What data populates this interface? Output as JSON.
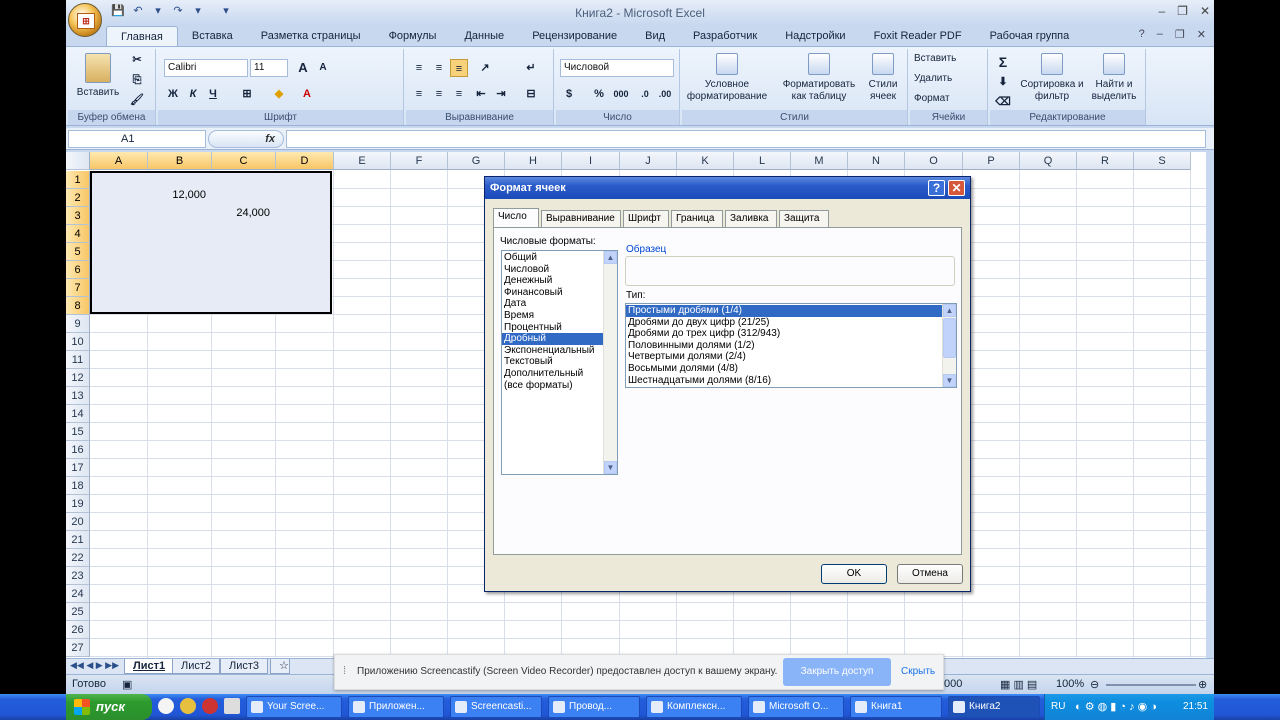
{
  "window": {
    "title": "Книга2 - Microsoft Excel",
    "controls": [
      "–",
      "❐",
      "✕"
    ],
    "office_logo": "Office"
  },
  "qat": [
    "💾",
    "↶",
    "▾",
    "↷",
    "▾",
    "▾"
  ],
  "tabs": [
    "Главная",
    "Вставка",
    "Разметка страницы",
    "Формулы",
    "Данные",
    "Рецензирование",
    "Вид",
    "Разработчик",
    "Надстройки",
    "Foxit Reader PDF",
    "Рабочая группа"
  ],
  "tabs_right": [
    "?",
    "–",
    "❐",
    "✕"
  ],
  "ribbon": {
    "groups": {
      "clipboard": "Буфер обмена",
      "font": "Шрифт",
      "alignment": "Выравнивание",
      "number": "Число",
      "styles": "Стили",
      "cells": "Ячейки",
      "editing": "Редактирование"
    },
    "paste": "Вставить",
    "font_name": "Calibri",
    "font_size": "11",
    "font_grow": "A",
    "font_shrink": "A",
    "bold": "Ж",
    "italic": "К",
    "underline": "Ч",
    "number_format": "Числовой",
    "percent": "%",
    "thousands": "000",
    "cond_format": "Условное форматирование",
    "format_table": "Форматировать как таблицу",
    "cell_styles": "Стили ячеек",
    "insert": "Вставить",
    "delete": "Удалить",
    "format": "Формат",
    "sigma": "Σ",
    "sort_filter": "Сортировка и фильтр",
    "find_select": "Найти и выделить"
  },
  "formula_bar": {
    "name_box": "A1",
    "fx": "fx",
    "value": ""
  },
  "columns": [
    "A",
    "B",
    "C",
    "D",
    "E",
    "F",
    "G",
    "H",
    "I",
    "J",
    "K",
    "L",
    "M",
    "N",
    "O",
    "P",
    "Q",
    "R",
    "S"
  ],
  "rows": [
    "1",
    "2",
    "3",
    "4",
    "5",
    "6",
    "7",
    "8",
    "9",
    "10",
    "11",
    "12",
    "13",
    "14",
    "15",
    "16",
    "17",
    "18",
    "19",
    "20",
    "21",
    "22",
    "23",
    "24",
    "25",
    "26",
    "27"
  ],
  "cells": {
    "B2": "12,000",
    "C3": "24,000"
  },
  "dialog": {
    "title": "Формат ячеек",
    "help": "?",
    "close": "✕",
    "tabs": [
      "Число",
      "Выравнивание",
      "Шрифт",
      "Граница",
      "Заливка",
      "Защита"
    ],
    "formats_label": "Числовые форматы:",
    "formats": [
      "Общий",
      "Числовой",
      "Денежный",
      "Финансовый",
      "Дата",
      "Время",
      "Процентный",
      "Дробный",
      "Экспоненциальный",
      "Текстовый",
      "Дополнительный",
      "(все форматы)"
    ],
    "selected_format": "Дробный",
    "sample_label": "Образец",
    "sample_value": "",
    "type_label": "Тип:",
    "types": [
      "Простыми дробями (1/4)",
      "Дробями до двух цифр (21/25)",
      "Дробями до трех цифр (312/943)",
      "Половинными долями (1/2)",
      "Четвертыми долями (2/4)",
      "Восьмыми долями (4/8)",
      "Шестнадцатыми долями (8/16)"
    ],
    "selected_type": "Простыми дробями (1/4)",
    "ok": "OK",
    "cancel": "Отмена"
  },
  "sheet_tabs": [
    "Лист1",
    "Лист2",
    "Лист3"
  ],
  "status": {
    "ready": "Готово",
    "zoom": "100%",
    "hidden_count": "000"
  },
  "notification": {
    "text": "Приложению Screencastify (Screen Video Recorder) предоставлен доступ к вашему экрану.",
    "stop": "Закрыть доступ",
    "hide": "Скрыть"
  },
  "taskbar": {
    "start": "пуск",
    "tasks": [
      "Your Scree...",
      "Приложен...",
      "Screencasti...",
      "Провод...",
      "Комплексн...",
      "Microsoft O...",
      "Книга1",
      "Книга2"
    ],
    "lang": "RU",
    "clock": "21:51"
  }
}
